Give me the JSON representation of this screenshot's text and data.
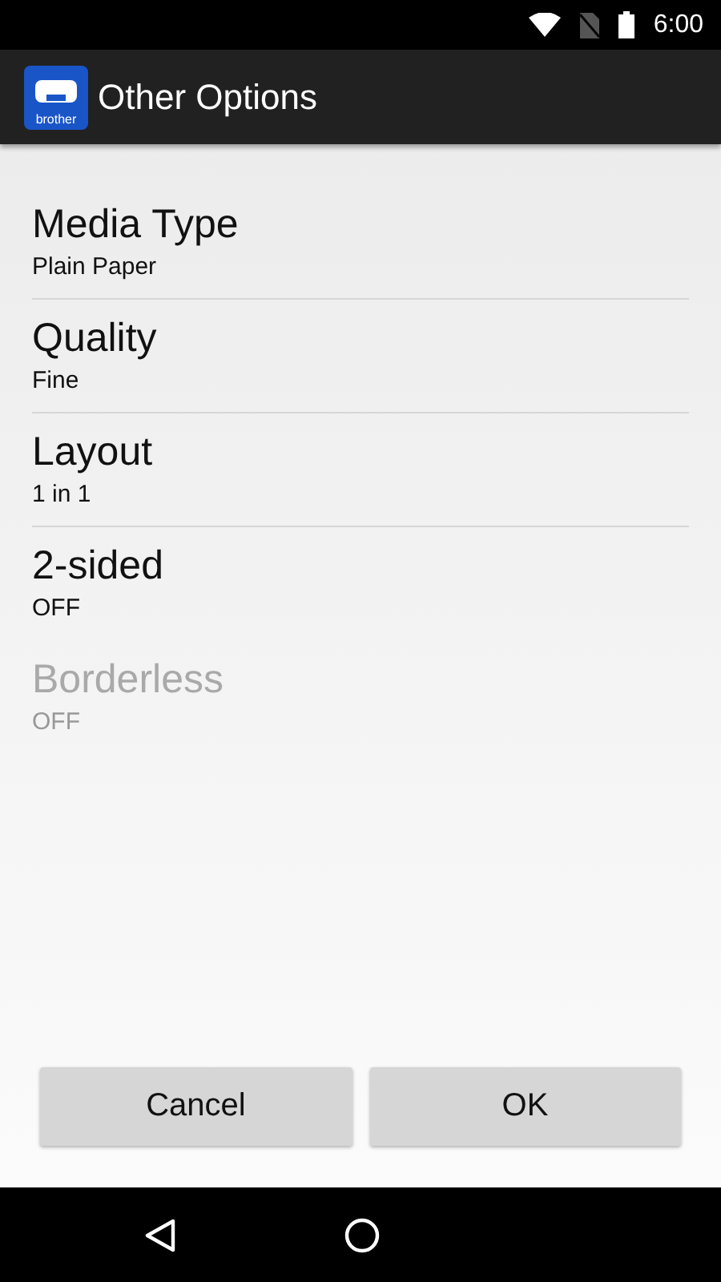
{
  "status_bar": {
    "time": "6:00"
  },
  "action_bar": {
    "app_icon_label": "brother",
    "title": "Other Options"
  },
  "options": [
    {
      "title": "Media Type",
      "value": "Plain Paper",
      "disabled": false,
      "divider": true
    },
    {
      "title": "Quality",
      "value": "Fine",
      "disabled": false,
      "divider": true
    },
    {
      "title": "Layout",
      "value": "1 in 1",
      "disabled": false,
      "divider": true
    },
    {
      "title": "2-sided",
      "value": "OFF",
      "disabled": false,
      "divider": false
    },
    {
      "title": "Borderless",
      "value": "OFF",
      "disabled": true,
      "divider": false
    }
  ],
  "buttons": [
    {
      "label": "Cancel"
    },
    {
      "label": "OK"
    }
  ]
}
